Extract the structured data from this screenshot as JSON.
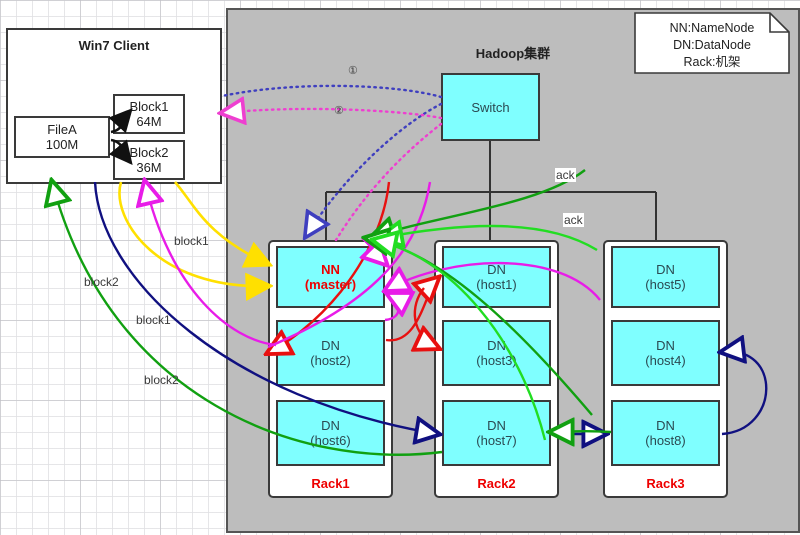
{
  "client": {
    "title": "Win7 Client",
    "file": {
      "name": "FileA",
      "size": "100M"
    },
    "blocks": [
      {
        "name": "Block1",
        "size": "64M"
      },
      {
        "name": "Block2",
        "size": "36M"
      }
    ]
  },
  "cluster": {
    "title": "Hadoop集群",
    "switch_label": "Switch",
    "racks": [
      {
        "label": "Rack1",
        "nodes": [
          {
            "role": "NN",
            "host": "(master)",
            "master": true
          },
          {
            "role": "DN",
            "host": "(host2)",
            "master": false
          },
          {
            "role": "DN",
            "host": "(host6)",
            "master": false
          }
        ]
      },
      {
        "label": "Rack2",
        "nodes": [
          {
            "role": "DN",
            "host": "(host1)",
            "master": false
          },
          {
            "role": "DN",
            "host": "(host3)",
            "master": false
          },
          {
            "role": "DN",
            "host": "(host7)",
            "master": false
          }
        ]
      },
      {
        "label": "Rack3",
        "nodes": [
          {
            "role": "DN",
            "host": "(host5)",
            "master": false
          },
          {
            "role": "DN",
            "host": "(host4)",
            "master": false
          },
          {
            "role": "DN",
            "host": "(host8)",
            "master": false
          }
        ]
      }
    ]
  },
  "legend": {
    "line1": "NN:NameNode",
    "line2": "DN:DataNode",
    "line3": "Rack:机架"
  },
  "annotations": {
    "step1": "①",
    "step2": "②",
    "block1_yellow": "block1",
    "block2_yellow": "block2",
    "block1_red": "block1",
    "block2_navy": "block2",
    "ack_top": "ack",
    "ack_bottom": "ack"
  },
  "colors": {
    "node_fill": "#7FFFFF",
    "node_stroke": "#3a3a3a",
    "cluster_bg": "#bdbdbd",
    "rack_label": "#ee0000",
    "nn_label": "#ee0000",
    "flow_blue_dotted": "#3f3fbf",
    "flow_magenta_dotted": "#ee3fd0",
    "flow_yellow": "#ffe000",
    "flow_red": "#e81010",
    "flow_magenta": "#e81ce8",
    "flow_navy": "#101080",
    "flow_green_dark": "#11a011",
    "flow_green_bright": "#22dd22"
  }
}
